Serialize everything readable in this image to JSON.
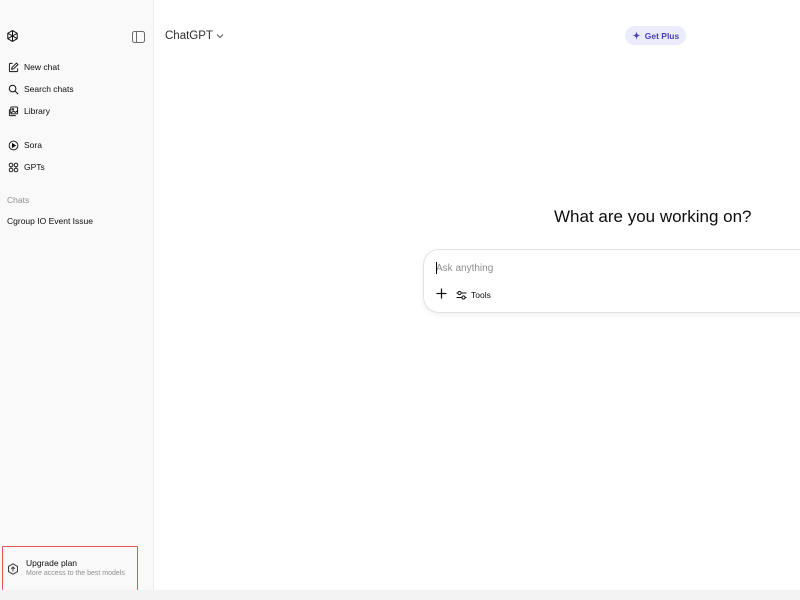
{
  "sidebar": {
    "logo_icon": "openai-logo-icon",
    "toggle_icon": "sidebar-toggle-icon",
    "primary_items": [
      {
        "label": "New chat",
        "icon": "edit-icon"
      },
      {
        "label": "Search chats",
        "icon": "search-icon"
      },
      {
        "label": "Library",
        "icon": "library-icon"
      }
    ],
    "secondary_items": [
      {
        "label": "Sora",
        "icon": "play-circle-icon"
      },
      {
        "label": "GPTs",
        "icon": "grid-icon"
      }
    ],
    "chats_label": "Chats",
    "chats": [
      {
        "title": "Cgroup IO Event Issue"
      }
    ],
    "upgrade": {
      "title": "Upgrade plan",
      "subtitle": "More access to the best models",
      "icon": "upgrade-icon"
    }
  },
  "header": {
    "model_name": "ChatGPT",
    "model_chevron": "chevron-down-icon",
    "get_plus_label": "Get Plus",
    "get_plus_icon": "sparkle-icon"
  },
  "main": {
    "heading": "What are you working on?",
    "composer": {
      "placeholder": "Ask anything",
      "value": "",
      "plus_icon": "plus-icon",
      "tools_label": "Tools",
      "tools_icon": "sliders-icon"
    }
  },
  "colors": {
    "sidebar_bg": "#f9f9f9",
    "accent_purple": "#4b41b8",
    "get_plus_bg": "#ecebfb",
    "highlight_border": "#e05858"
  }
}
